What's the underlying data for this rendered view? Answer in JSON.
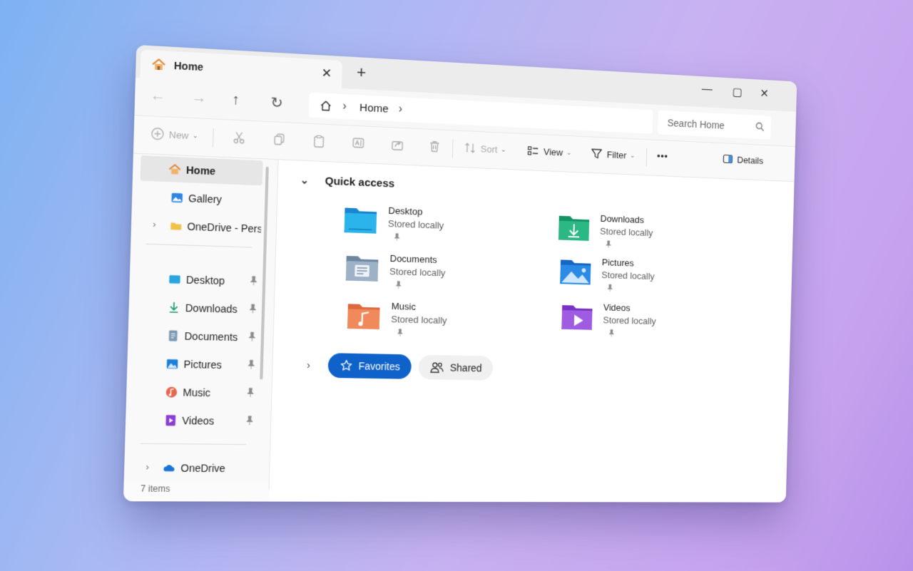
{
  "tab": {
    "title": "Home",
    "close_glyph": "✕",
    "new_tab_glyph": "+"
  },
  "window_controls": {
    "minimize": "—",
    "maximize": "▢",
    "close": "✕"
  },
  "nav": {
    "back": "←",
    "forward": "→",
    "up": "↑",
    "refresh": "↻"
  },
  "address": {
    "crumb": "Home",
    "chevron": "›"
  },
  "search": {
    "placeholder": "Search Home"
  },
  "toolbar": {
    "new_label": "New",
    "sort_label": "Sort",
    "view_label": "View",
    "filter_label": "Filter",
    "more_label": "•••",
    "details_label": "Details",
    "caret": "⌄"
  },
  "sidebar": {
    "items": [
      {
        "label": "Home",
        "icon": "home-icon"
      },
      {
        "label": "Gallery",
        "icon": "gallery-icon"
      },
      {
        "label": "OneDrive - Perso",
        "icon": "folder-icon",
        "expander": "›"
      },
      {
        "label": "Desktop",
        "icon": "desktop-icon"
      },
      {
        "label": "Downloads",
        "icon": "download-icon"
      },
      {
        "label": "Documents",
        "icon": "documents-icon"
      },
      {
        "label": "Pictures",
        "icon": "pictures-icon"
      },
      {
        "label": "Music",
        "icon": "music-icon"
      },
      {
        "label": "Videos",
        "icon": "videos-icon"
      },
      {
        "label": "OneDrive",
        "icon": "cloud-icon",
        "expander": "›"
      }
    ]
  },
  "status": {
    "text": "7 items"
  },
  "quick_access": {
    "title": "Quick access",
    "collapse_glyph": "⌄",
    "folders": [
      {
        "name": "Desktop",
        "subtitle": "Stored locally",
        "icon": "desktop-folder-icon"
      },
      {
        "name": "Downloads",
        "subtitle": "Stored locally",
        "icon": "downloads-folder-icon"
      },
      {
        "name": "Documents",
        "subtitle": "Stored locally",
        "icon": "documents-folder-icon"
      },
      {
        "name": "Pictures",
        "subtitle": "Stored locally",
        "icon": "pictures-folder-icon"
      },
      {
        "name": "Music",
        "subtitle": "Stored locally",
        "icon": "music-folder-icon"
      },
      {
        "name": "Videos",
        "subtitle": "Stored locally",
        "icon": "videos-folder-icon"
      }
    ]
  },
  "sections": {
    "expand_glyph": "›",
    "favorites": "Favorites",
    "shared": "Shared"
  },
  "colors": {
    "accent": "#0f62c9",
    "selected_bg": "#e6e6e6"
  }
}
